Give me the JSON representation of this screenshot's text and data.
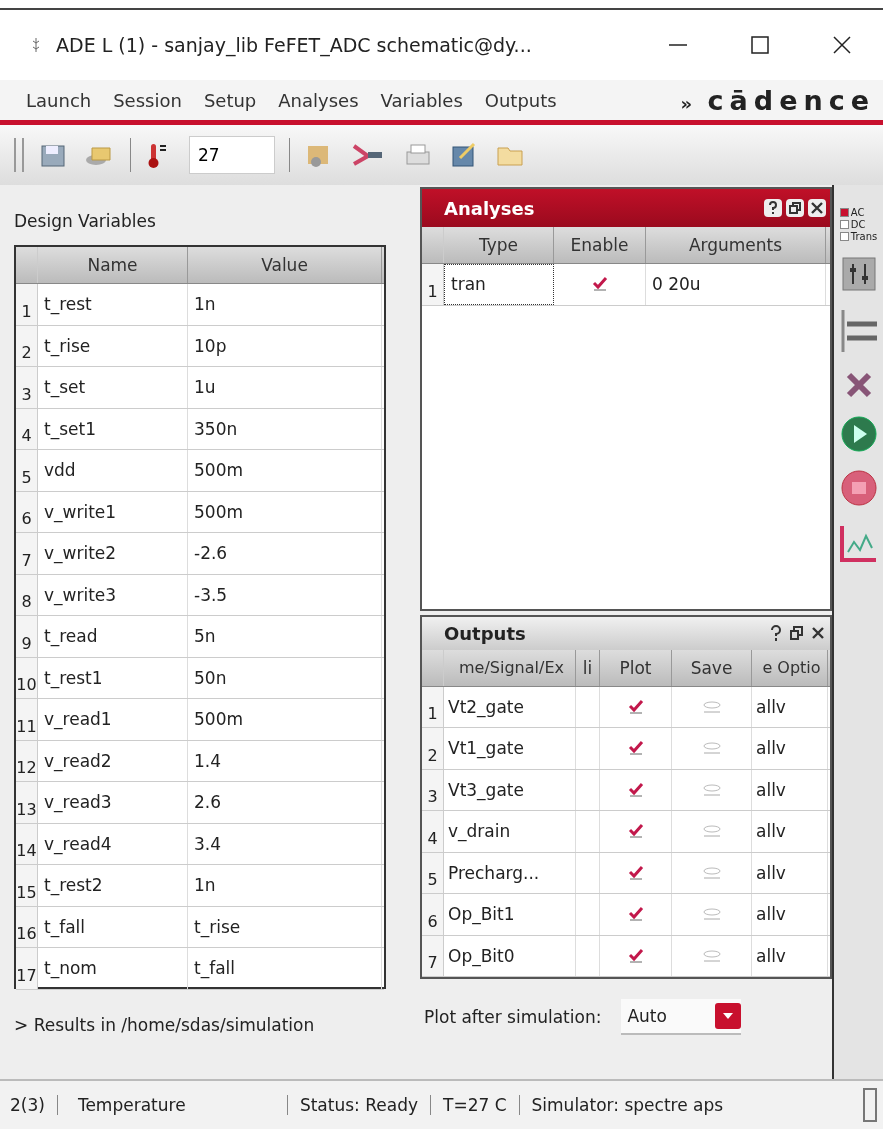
{
  "window": {
    "title": "ADE L (1) - sanjay_lib FeFET_ADC schematic@dy..."
  },
  "menu": [
    "Launch",
    "Session",
    "Setup",
    "Analyses",
    "Variables",
    "Outputs"
  ],
  "brand": {
    "prefix": "»",
    "name": "cādence"
  },
  "toolbar": {
    "temperature": "27"
  },
  "design_variables": {
    "title": "Design Variables",
    "columns": [
      "Name",
      "Value"
    ],
    "rows": [
      {
        "index": "1",
        "name": "t_rest",
        "value": "1n"
      },
      {
        "index": "2",
        "name": "t_rise",
        "value": "10p"
      },
      {
        "index": "3",
        "name": "t_set",
        "value": "1u"
      },
      {
        "index": "4",
        "name": "t_set1",
        "value": "350n"
      },
      {
        "index": "5",
        "name": "vdd",
        "value": "500m"
      },
      {
        "index": "6",
        "name": "v_write1",
        "value": "500m"
      },
      {
        "index": "7",
        "name": "v_write2",
        "value": "-2.6"
      },
      {
        "index": "8",
        "name": "v_write3",
        "value": "-3.5"
      },
      {
        "index": "9",
        "name": "t_read",
        "value": "5n"
      },
      {
        "index": "10",
        "name": "t_rest1",
        "value": "50n"
      },
      {
        "index": "11",
        "name": "v_read1",
        "value": "500m"
      },
      {
        "index": "12",
        "name": "v_read2",
        "value": "1.4"
      },
      {
        "index": "13",
        "name": "v_read3",
        "value": "2.6"
      },
      {
        "index": "14",
        "name": "v_read4",
        "value": "3.4"
      },
      {
        "index": "15",
        "name": "t_rest2",
        "value": "1n"
      },
      {
        "index": "16",
        "name": "t_fall",
        "value": "t_rise"
      },
      {
        "index": "17",
        "name": "t_nom",
        "value": "t_fall"
      }
    ]
  },
  "results": "> Results in /home/sdas/simulation",
  "analyses": {
    "title": "Analyses",
    "columns": [
      "Type",
      "Enable",
      "Arguments"
    ],
    "rows": [
      {
        "index": "1",
        "type": "tran",
        "enabled": true,
        "arguments": "0 20u"
      }
    ]
  },
  "outputs": {
    "title": "Outputs",
    "columns": [
      "me/Signal/Ex",
      "li",
      "Plot",
      "Save",
      "e Optio"
    ],
    "rows": [
      {
        "index": "1",
        "name": "Vt2_gate",
        "plot": true,
        "save": false,
        "options": "allv"
      },
      {
        "index": "2",
        "name": "Vt1_gate",
        "plot": true,
        "save": false,
        "options": "allv"
      },
      {
        "index": "3",
        "name": "Vt3_gate",
        "plot": true,
        "save": false,
        "options": "allv"
      },
      {
        "index": "4",
        "name": "v_drain",
        "plot": true,
        "save": false,
        "options": "allv"
      },
      {
        "index": "5",
        "name": "Precharg...",
        "plot": true,
        "save": false,
        "options": "allv"
      },
      {
        "index": "6",
        "name": "Op_Bit1",
        "plot": true,
        "save": false,
        "options": "allv"
      },
      {
        "index": "7",
        "name": "Op_Bit0",
        "plot": true,
        "save": false,
        "options": "allv"
      }
    ]
  },
  "plot_after": {
    "label": "Plot after simulation:",
    "value": "Auto"
  },
  "analysis_types": [
    {
      "label": "AC",
      "selected": true
    },
    {
      "label": "DC",
      "selected": false
    },
    {
      "label": "Trans",
      "selected": false
    }
  ],
  "status_bar": [
    "2(3)",
    "Temperature",
    "Status: Ready",
    "T=27 C",
    "Simulator: spectre aps"
  ]
}
